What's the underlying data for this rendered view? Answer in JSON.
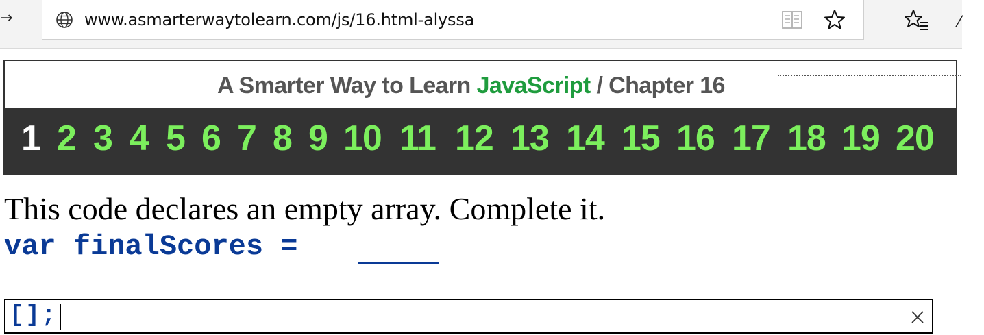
{
  "browser": {
    "url": "www.asmarterwaytolearn.com/js/16.html-alyssa",
    "icons": [
      "back-arrow-icon",
      "globe-icon",
      "reading-view-icon",
      "favorite-star-icon",
      "favorites-list-icon"
    ]
  },
  "header": {
    "title_prefix": "A Smarter Way to Learn",
    "title_highlight": "JavaScript",
    "title_suffix": "/ Chapter 16",
    "highlight_color": "#1f9c3e"
  },
  "chapters": {
    "current": "1",
    "items": [
      "1",
      "2",
      "3",
      "4",
      "5",
      "6",
      "7",
      "8",
      "9",
      "10",
      "11",
      "12",
      "13",
      "14",
      "15",
      "16",
      "17",
      "18",
      "19",
      "20"
    ],
    "link_color": "#7cef5d",
    "bar_color": "#333333"
  },
  "exercise": {
    "prompt": "This code declares an empty array. Complete it.",
    "code": "var finalScores = ",
    "code_color": "#0a3a96",
    "answer_value": "[];"
  }
}
